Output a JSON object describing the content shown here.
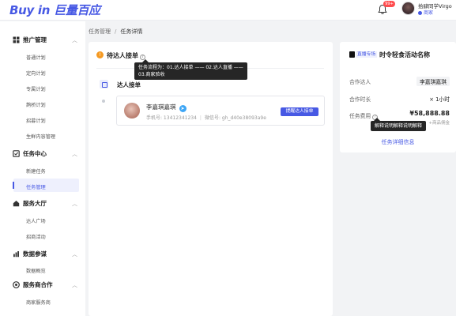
{
  "header": {
    "logo": "Buy in 巨量百应",
    "notification_count": "99+",
    "user_name": "拾肆同学Virgo",
    "user_role": "商家"
  },
  "sidebar": {
    "groups": [
      {
        "label": "推广管理",
        "items": [
          "普通计划",
          "定向计划",
          "专属计划",
          "鹊桥计划",
          "招募计划",
          "生鲜内容管理"
        ]
      },
      {
        "label": "任务中心",
        "items": [
          "新建任务",
          "任务管理"
        ]
      },
      {
        "label": "服务大厅",
        "items": [
          "达人广场",
          "招商活动"
        ]
      },
      {
        "label": "数据参谋",
        "items": [
          "数据概览"
        ]
      },
      {
        "label": "服务商合作",
        "items": [
          "商家服务商"
        ]
      }
    ],
    "active_item": "任务管理"
  },
  "breadcrumb": {
    "parent": "任务管理",
    "separator": "/",
    "current": "任务详情"
  },
  "main": {
    "section_title": "待达人接单",
    "tooltip": "任务流程为：01.达人接单 —— 02.达人直播 —— 03.商家验收",
    "step_title": "达人接单",
    "talent": {
      "name": "李嘉琪嘉琪",
      "contact": "手机号: 13412341234",
      "wechat": "微信号: gh_d40e38093a9e",
      "button": "提醒达人接单"
    }
  },
  "task_panel": {
    "tag": "直播专场",
    "title": "时令轻食活动名称",
    "rows": [
      {
        "label": "合作达人",
        "value": "李嘉琪嘉琪"
      },
      {
        "label": "合作时长",
        "value": "× 1小时"
      },
      {
        "label": "任务费用",
        "value": "¥58,888.88",
        "sub": "+商品佣金"
      }
    ],
    "tooltip": "解释说明解释说明解释",
    "link": "任务详细信息"
  },
  "colors": {
    "accent": "#4759e4",
    "warning": "#f59a23",
    "badge": "#ff4d4f"
  }
}
